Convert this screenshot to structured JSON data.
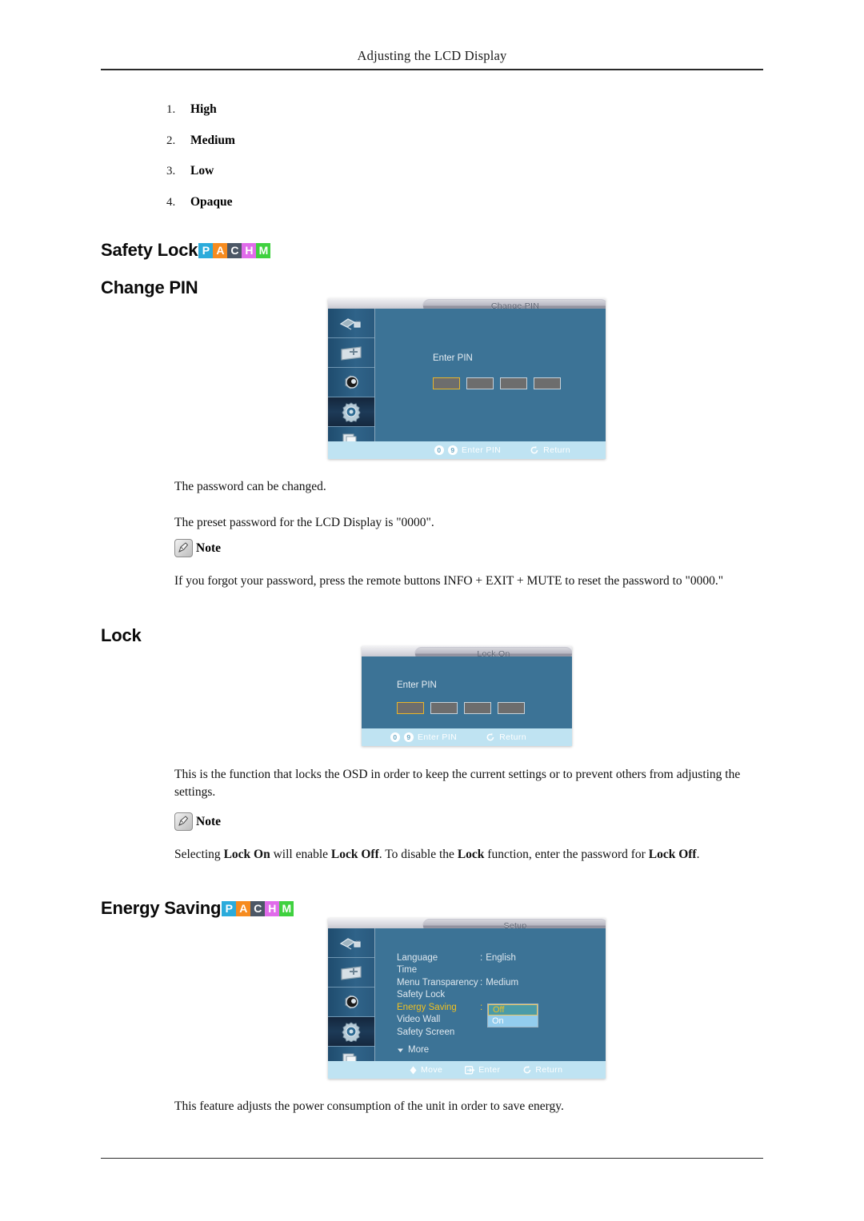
{
  "page": {
    "header_title": "Adjusting the LCD Display"
  },
  "transparency_list": [
    {
      "num": "1.",
      "label": "High"
    },
    {
      "num": "2.",
      "label": "Medium"
    },
    {
      "num": "3.",
      "label": "Low"
    },
    {
      "num": "4.",
      "label": "Opaque"
    }
  ],
  "badges": {
    "letters": [
      "P",
      "A",
      "C",
      "H",
      "M"
    ],
    "colors": [
      "#2babdb",
      "#f68b1f",
      "#4c5766",
      "#e06bea",
      "#3fd13f"
    ]
  },
  "sections": {
    "safety_lock": {
      "heading": "Safety Lock",
      "sub_heading": "Change PIN",
      "para1": "The password can be changed.",
      "para2": "The preset password for the LCD Display is \"0000\".",
      "note_label": "Note",
      "note_body": "If you forgot your password, press the remote buttons INFO + EXIT + MUTE to reset the password to \"0000.\""
    },
    "lock": {
      "heading": "Lock",
      "para1": "This is the function that locks the OSD in order to keep the current settings or to prevent others from adjusting the settings.",
      "note_label": "Note",
      "note_body_parts": [
        {
          "t": "Selecting ",
          "b": false
        },
        {
          "t": "Lock On",
          "b": true
        },
        {
          "t": " will enable ",
          "b": false
        },
        {
          "t": "Lock Off",
          "b": true
        },
        {
          "t": ". To disable the ",
          "b": false
        },
        {
          "t": "Lock",
          "b": true
        },
        {
          "t": " function, enter the password for ",
          "b": false
        },
        {
          "t": "Lock Off",
          "b": true
        },
        {
          "t": ".",
          "b": false
        }
      ]
    },
    "energy_saving": {
      "heading": "Energy Saving",
      "para1": "This feature adjusts the power consumption of the unit in order to save energy."
    }
  },
  "osd_change_pin": {
    "title": "Change PIN",
    "enter_pin_label": "Enter PIN",
    "pin_boxes": 4,
    "active_box_index": 0,
    "sidebar_icons": [
      "input-source-icon",
      "picture-icon",
      "sound-icon",
      "setup-gear-icon",
      "multi-control-icon"
    ],
    "selected_sidebar_index": 3,
    "bottom_keys": [
      "0",
      "9"
    ],
    "bottom_action": "Enter PIN",
    "bottom_return": "Return"
  },
  "osd_lock_on": {
    "title": "Lock On",
    "enter_pin_label": "Enter PIN",
    "pin_boxes": 4,
    "active_box_index": 0,
    "bottom_keys": [
      "0",
      "9"
    ],
    "bottom_action": "Enter PIN",
    "bottom_return": "Return"
  },
  "osd_setup": {
    "title": "Setup",
    "sidebar_icons": [
      "input-source-icon",
      "picture-icon",
      "sound-icon",
      "setup-gear-icon",
      "multi-control-icon"
    ],
    "selected_sidebar_index": 3,
    "menu_items": [
      {
        "name": "Language",
        "colon": ":",
        "value": "English",
        "highlighted": false
      },
      {
        "name": "Time",
        "colon": "",
        "value": "",
        "highlighted": false
      },
      {
        "name": "Menu Transparency",
        "colon": ":",
        "value": "Medium",
        "highlighted": false
      },
      {
        "name": "Safety Lock",
        "colon": "",
        "value": "",
        "highlighted": false
      },
      {
        "name": "Energy Saving",
        "colon": ":",
        "value": "",
        "highlighted": true
      },
      {
        "name": "Video Wall",
        "colon": "",
        "value": "",
        "highlighted": false
      },
      {
        "name": "Safety Screen",
        "colon": "",
        "value": "",
        "highlighted": false
      }
    ],
    "more_label": "More",
    "dropdown_options": [
      {
        "label": "Off",
        "selected": true
      },
      {
        "label": "On",
        "selected": false
      }
    ],
    "bottom_move": "Move",
    "bottom_enter": "Enter",
    "bottom_return": "Return"
  },
  "colors": {
    "osd_background": "#3c7396",
    "osd_bottom_bar": "#bfe3f2",
    "highlight_yellow": "#f0c020",
    "dropdown_off_bg": "#4a9ba8",
    "dropdown_on_bg": "#93cdee"
  }
}
